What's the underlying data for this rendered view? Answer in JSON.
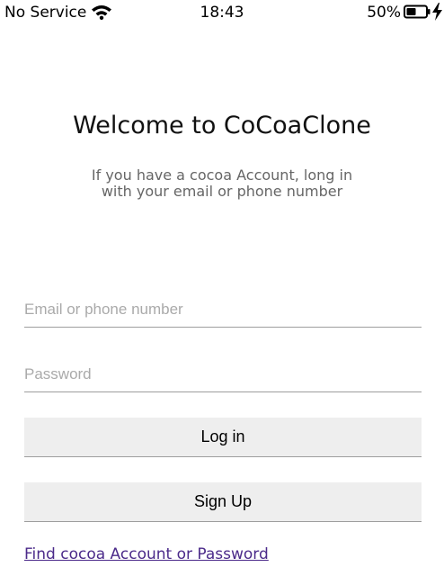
{
  "status_bar": {
    "carrier": "No Service",
    "wifi_icon": "wifi-icon",
    "time": "18:43",
    "battery_percent": "50%",
    "battery_icon": "battery-icon",
    "charging_icon": "charging-bolt-icon",
    "battery_level": 0.5
  },
  "header": {
    "title": "Welcome to CoCoaClone",
    "subtitle": "If you have a cocoa Account, long in with your email or phone number"
  },
  "form": {
    "email_placeholder": "Email or phone number",
    "email_value": "",
    "password_placeholder": "Password",
    "password_value": ""
  },
  "buttons": {
    "login_label": "Log in",
    "signup_label": "Sign Up"
  },
  "links": {
    "find_account": "Find cocoa Account or Password"
  },
  "colors": {
    "button_bg": "#eeeeee",
    "divider": "#9e9e9e",
    "link": "#4b2a8a",
    "subtitle": "#666666"
  }
}
